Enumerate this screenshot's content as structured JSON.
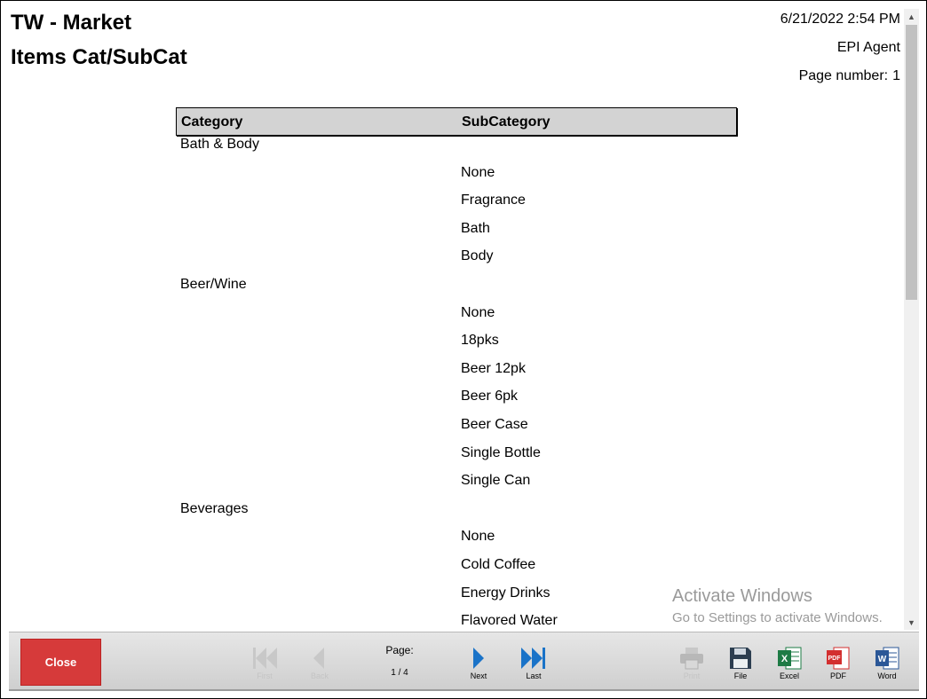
{
  "report": {
    "title": "TW - Market",
    "subtitle": "Items Cat/SubCat",
    "date": "6/21/2022 2:54 PM",
    "user": "EPI Agent",
    "page_number_label": "Page number:",
    "page_number": "1"
  },
  "table": {
    "headers": [
      "Category",
      "SubCategory"
    ],
    "rows": [
      {
        "kind": "cat",
        "text": "Bath & Body"
      },
      {
        "kind": "sub",
        "text": "None"
      },
      {
        "kind": "sub",
        "text": "Fragrance"
      },
      {
        "kind": "sub",
        "text": "Bath"
      },
      {
        "kind": "sub",
        "text": "Body"
      },
      {
        "kind": "cat",
        "text": "Beer/Wine"
      },
      {
        "kind": "sub",
        "text": "None"
      },
      {
        "kind": "sub",
        "text": "18pks"
      },
      {
        "kind": "sub",
        "text": "Beer 12pk"
      },
      {
        "kind": "sub",
        "text": "Beer 6pk"
      },
      {
        "kind": "sub",
        "text": "Beer Case"
      },
      {
        "kind": "sub",
        "text": "Single Bottle"
      },
      {
        "kind": "sub",
        "text": "Single Can"
      },
      {
        "kind": "cat",
        "text": "Beverages"
      },
      {
        "kind": "sub",
        "text": "None"
      },
      {
        "kind": "sub",
        "text": "Cold Coffee"
      },
      {
        "kind": "sub",
        "text": "Energy Drinks"
      },
      {
        "kind": "sub",
        "text": "Flavored Water"
      }
    ]
  },
  "watermark": {
    "line1": "Activate Windows",
    "line2": "Go to Settings to activate Windows."
  },
  "toolbar": {
    "close_label": "Close",
    "first_label": "First",
    "back_label": "Back",
    "page_label": "Page:",
    "page_value": "1 / 4",
    "next_label": "Next",
    "last_label": "Last",
    "print_label": "Print",
    "file_label": "File",
    "excel_label": "Excel",
    "pdf_label": "PDF",
    "word_label": "Word"
  },
  "colors": {
    "close_button": "#d63a3a",
    "nav_arrow": "#1a73c8",
    "excel": "#1e7b45",
    "pdf": "#d32f2f",
    "word": "#2b5797"
  }
}
